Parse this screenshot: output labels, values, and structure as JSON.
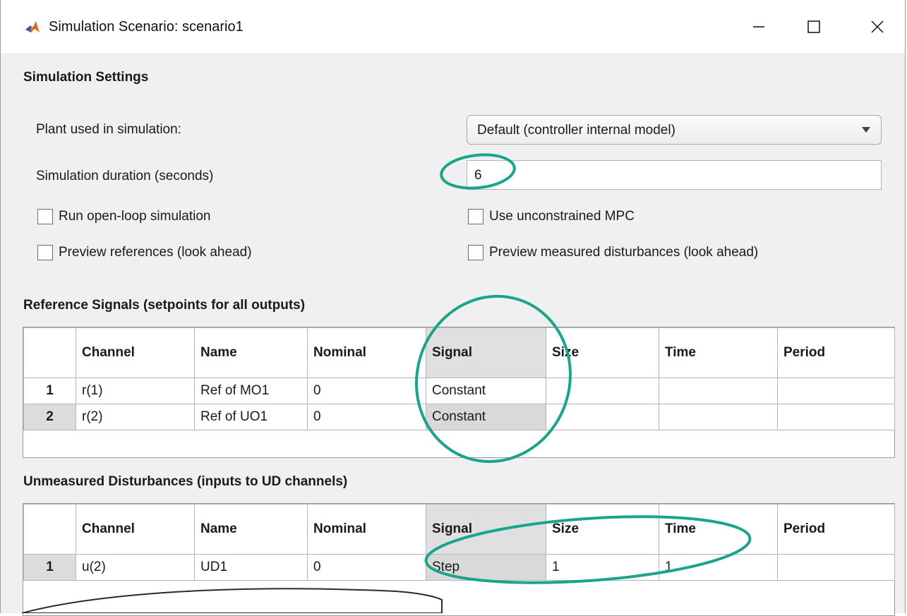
{
  "window": {
    "title": "Simulation Scenario: scenario1",
    "icon": "matlab-icon",
    "controls": [
      "minimize-icon",
      "maximize-icon",
      "close-icon"
    ]
  },
  "settings": {
    "heading": "Simulation Settings",
    "plant_label": "Plant used in simulation:",
    "plant_value": "Default (controller internal model)",
    "duration_label": "Simulation duration (seconds)",
    "duration_value": "6",
    "open_loop_label": "Run open-loop simulation",
    "open_loop_checked": false,
    "unconstrained_label": "Use unconstrained MPC",
    "unconstrained_checked": false,
    "preview_refs_label": "Preview references (look ahead)",
    "preview_refs_checked": false,
    "preview_md_label": "Preview measured disturbances (look ahead)",
    "preview_md_checked": false
  },
  "reference": {
    "heading": "Reference Signals (setpoints for all outputs)",
    "columns": [
      "",
      "Channel",
      "Name",
      "Nominal",
      "Signal",
      "Size",
      "Time",
      "Period"
    ],
    "rows": [
      {
        "idx": "1",
        "channel": "r(1)",
        "name": "Ref of MO1",
        "nominal": "0",
        "signal": "Constant",
        "size": "",
        "time": "",
        "period": ""
      },
      {
        "idx": "2",
        "channel": "r(2)",
        "name": "Ref of UO1",
        "nominal": "0",
        "signal": "Constant",
        "size": "",
        "time": "",
        "period": ""
      }
    ]
  },
  "unmeasured": {
    "heading": "Unmeasured Disturbances (inputs to UD channels)",
    "columns": [
      "",
      "Channel",
      "Name",
      "Nominal",
      "Signal",
      "Size",
      "Time",
      "Period"
    ],
    "rows": [
      {
        "idx": "1",
        "channel": "u(2)",
        "name": "UD1",
        "nominal": "0",
        "signal": "Step",
        "size": "1",
        "time": "1",
        "period": ""
      }
    ]
  },
  "colors": {
    "annotation": "#1aa58a",
    "selected_gray": "#d9d9d9",
    "window_bg": "#f0f0f0"
  }
}
